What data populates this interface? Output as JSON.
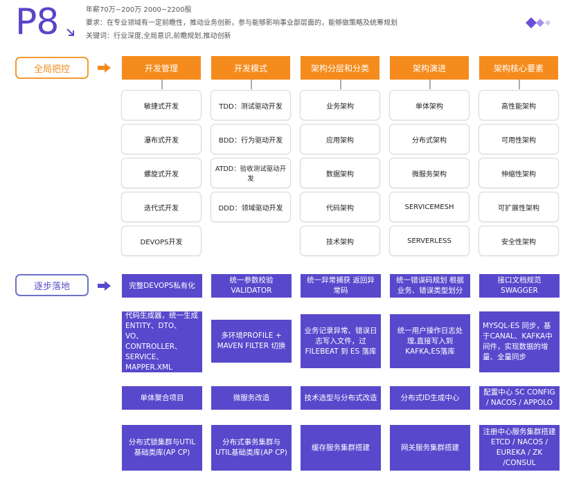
{
  "header": {
    "level": "P8",
    "salary": "年薪70万~200万 2000~2200股",
    "requirement": "要求：在专业领域有一定前瞻性，推动业务创新，参与能够影响事业部层面的，能够做策略及统筹规划",
    "keywords": "关键词：行业深度,全局意识,前瞻规划,推动创新"
  },
  "colors": {
    "brand": "#5b45c7",
    "orange": "#f58b1c",
    "purple": "#5848cc"
  },
  "section1": {
    "label": "全局把控",
    "columns": [
      {
        "title": "开发管理",
        "items": [
          "敏捷式开发",
          "瀑布式开发",
          "螺旋式开发",
          "迭代式开发",
          "DEVOPS开发"
        ]
      },
      {
        "title": "开发模式",
        "items": [
          "TDD：测试驱动开发",
          "BDD：行为驱动开发",
          "ATDD：验收测试驱动开发",
          "DDD：领域驱动开发"
        ]
      },
      {
        "title": "架构分层和分类",
        "items": [
          "业务架构",
          "应用架构",
          "数据架构",
          "代码架构",
          "技术架构"
        ]
      },
      {
        "title": "架构演进",
        "items": [
          "单体架构",
          "分布式架构",
          "微服务架构",
          "SERVICEMESH",
          "SERVERLESS"
        ]
      },
      {
        "title": "架构核心要素",
        "items": [
          "高性能架构",
          "可用性架构",
          "伸缩性架构",
          "可扩展性架构",
          "安全性架构"
        ]
      }
    ]
  },
  "section2": {
    "label": "逐步落地",
    "rows": [
      [
        "完整DEVOPS私有化",
        "统一参数校验 VALIDATOR",
        "统一异常捕获 返回异常码",
        "统一错误码规划 根据业务、错误类型划分",
        "接口文档规范 SWAGGER"
      ],
      [
        "代码生成器，统一生成ENTITY、DTO、VO、CONTROLLER、SERVICE、MAPPER.XML",
        "多环境PROFILE + MAVEN FILTER 切换",
        "业务记录异常、错误日志写入文件，过FILEBEAT 到 ES 落库",
        "统一用户操作日志处理,直接写入到KAFKA,ES落库",
        "MYSQL-ES 同步，基于CANAL、KAFKA中间件，实现数据的增量、全量同步"
      ],
      [
        "单体聚合项目",
        "微服务改造",
        "技术选型与分布式改造",
        "分布式ID生成中心",
        "配置中心 SC CONFIG / NACOS / APPOLO"
      ],
      [
        "分布式锁集群与UTIL基础类库(AP CP)",
        "分布式事务集群与UTIL基础类库(AP CP)",
        "缓存服务集群搭建",
        "网关服务集群搭建",
        "注册中心服务集群搭建 ETCD / NACOS / EUREKA / ZK /CONSUL"
      ]
    ]
  }
}
